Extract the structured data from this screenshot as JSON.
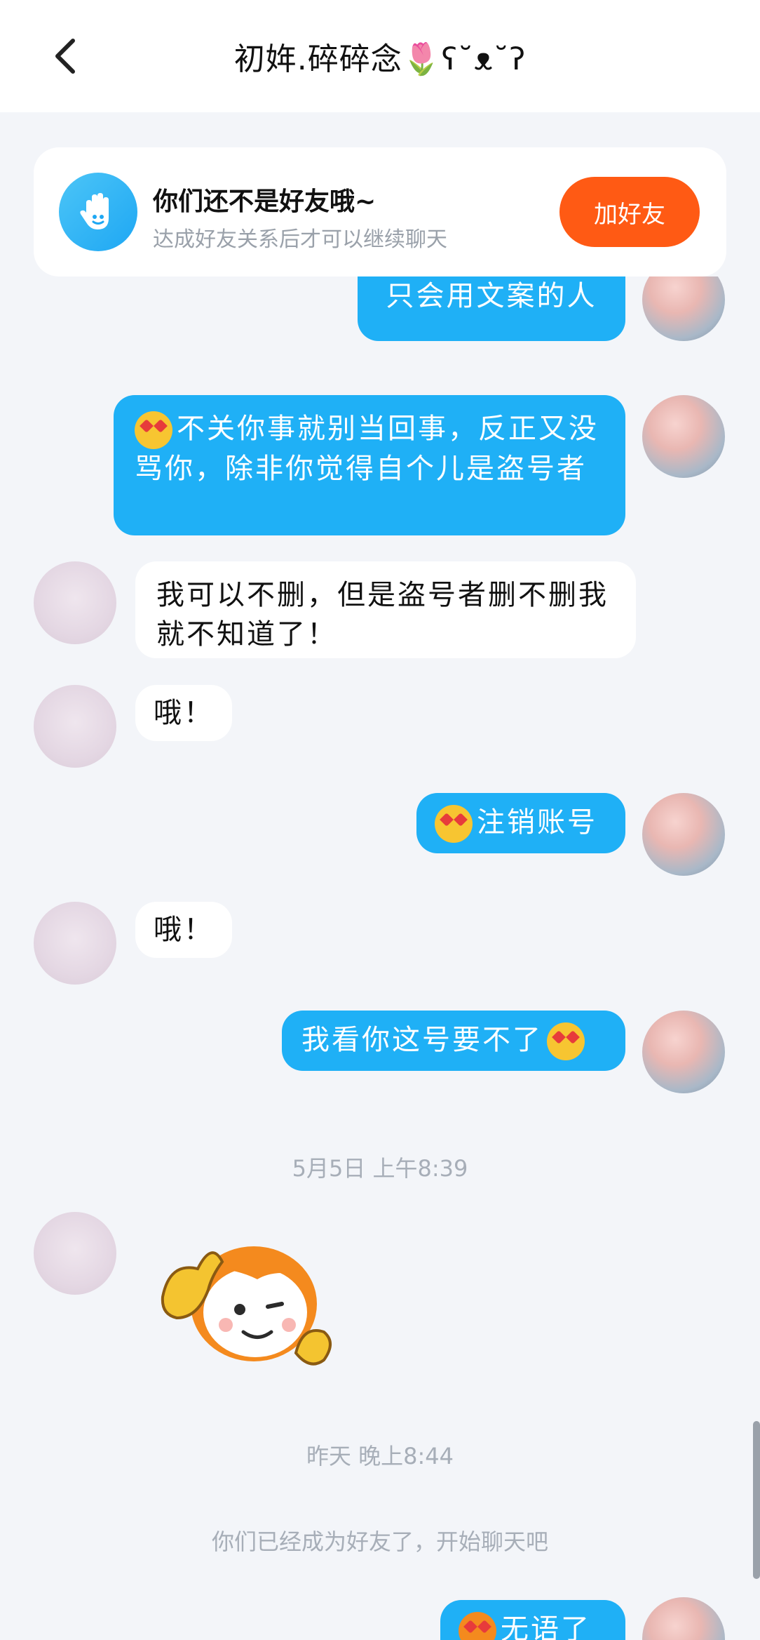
{
  "header": {
    "title": "初姩.碎碎念🌷ʕ˘ᴥ˘ʔ"
  },
  "friend_card": {
    "title": "你们还不是好友哦~",
    "subtitle": "达成好友关系后才可以继续聊天",
    "add_label": "加好友"
  },
  "messages": [
    {
      "side": "right",
      "text": "只会用文案的人"
    },
    {
      "side": "right",
      "text": "不关你事就别当回事，反正又没骂你，除非你觉得自个儿是盗号者"
    },
    {
      "side": "left",
      "text": "我可以不删，但是盗号者删不删我就不知道了！"
    },
    {
      "side": "left",
      "text": "哦！"
    },
    {
      "side": "right",
      "text": "注销账号"
    },
    {
      "side": "left",
      "text": "哦！"
    },
    {
      "side": "right",
      "text": "我看你这号要不了"
    },
    {
      "side": "right",
      "text": "无语了"
    }
  ],
  "timestamps": [
    "5月5日 上午8:39",
    "昨天 晚上8:44"
  ],
  "system_note": "你们已经成为好友了，开始聊天吧",
  "colors": {
    "accent": "#1fb0f6",
    "add_button": "#ff5a14",
    "background": "#f3f5f9"
  }
}
